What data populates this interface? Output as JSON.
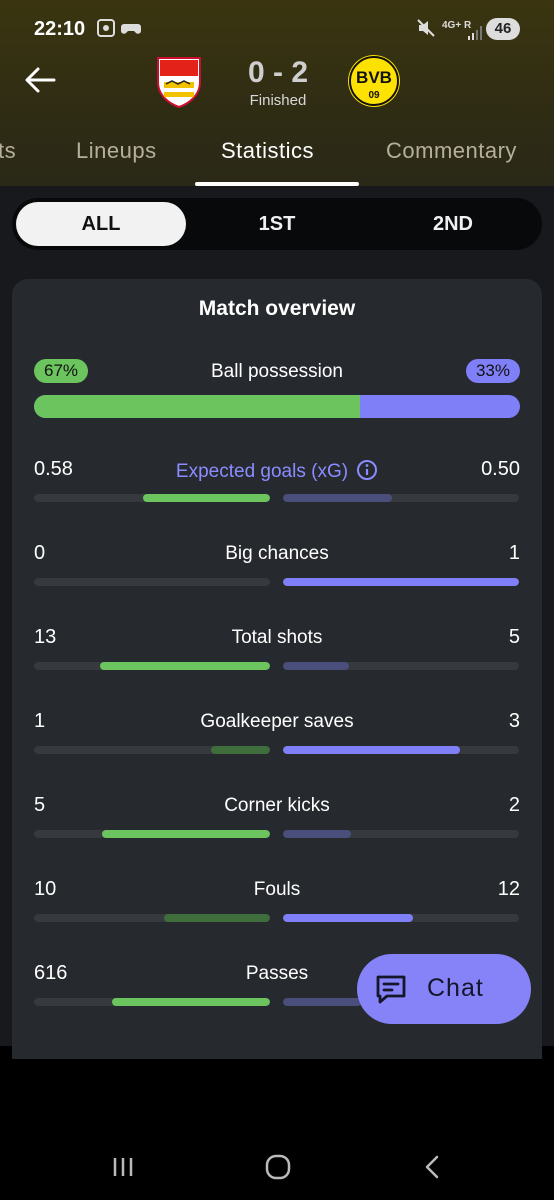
{
  "status_bar": {
    "time": "22:10",
    "network": "4G+",
    "roaming": "R",
    "battery": "46"
  },
  "match": {
    "score": "0 - 2",
    "status": "Finished",
    "home_crest": "vfb-stuttgart-crest",
    "away_crest": "bvb-crest",
    "away_crest_text": "BVB",
    "away_crest_year": "09"
  },
  "tabs": [
    {
      "label": "ts",
      "active": false
    },
    {
      "label": "Lineups",
      "active": false
    },
    {
      "label": "Statistics",
      "active": true
    },
    {
      "label": "Commentary",
      "active": false
    }
  ],
  "periods": [
    {
      "label": "ALL",
      "active": true
    },
    {
      "label": "1ST",
      "active": false
    },
    {
      "label": "2ND",
      "active": false
    }
  ],
  "card": {
    "title": "Match overview",
    "possession": {
      "label": "Ball possession",
      "home": "67%",
      "away": "33%",
      "home_fraction": 0.67
    },
    "stats": [
      {
        "label": "Expected goals (xG)",
        "home": "0.58",
        "away": "0.50",
        "home_fraction": 0.54,
        "away_fraction": 0.46,
        "home_lead": true,
        "info": true
      },
      {
        "label": "Big chances",
        "home": "0",
        "away": "1",
        "home_fraction": 0.0,
        "away_fraction": 1.0,
        "home_lead": false
      },
      {
        "label": "Total shots",
        "home": "13",
        "away": "5",
        "home_fraction": 0.72,
        "away_fraction": 0.28,
        "home_lead": true
      },
      {
        "label": "Goalkeeper saves",
        "home": "1",
        "away": "3",
        "home_fraction": 0.25,
        "away_fraction": 0.75,
        "home_lead": false
      },
      {
        "label": "Corner kicks",
        "home": "5",
        "away": "2",
        "home_fraction": 0.71,
        "away_fraction": 0.29,
        "home_lead": true
      },
      {
        "label": "Fouls",
        "home": "10",
        "away": "12",
        "home_fraction": 0.45,
        "away_fraction": 0.55,
        "home_lead": false
      },
      {
        "label": "Passes",
        "home": "616",
        "away": "",
        "home_fraction": 0.67,
        "away_fraction": 0.33,
        "home_lead": true
      }
    ]
  },
  "chat_button": {
    "label": "Chat"
  },
  "colors": {
    "home": "#6bc45e",
    "home_dim": "#3f6e3c",
    "away": "#7f7ff8",
    "away_dim": "#4a4e7a",
    "track": "#36393e"
  }
}
